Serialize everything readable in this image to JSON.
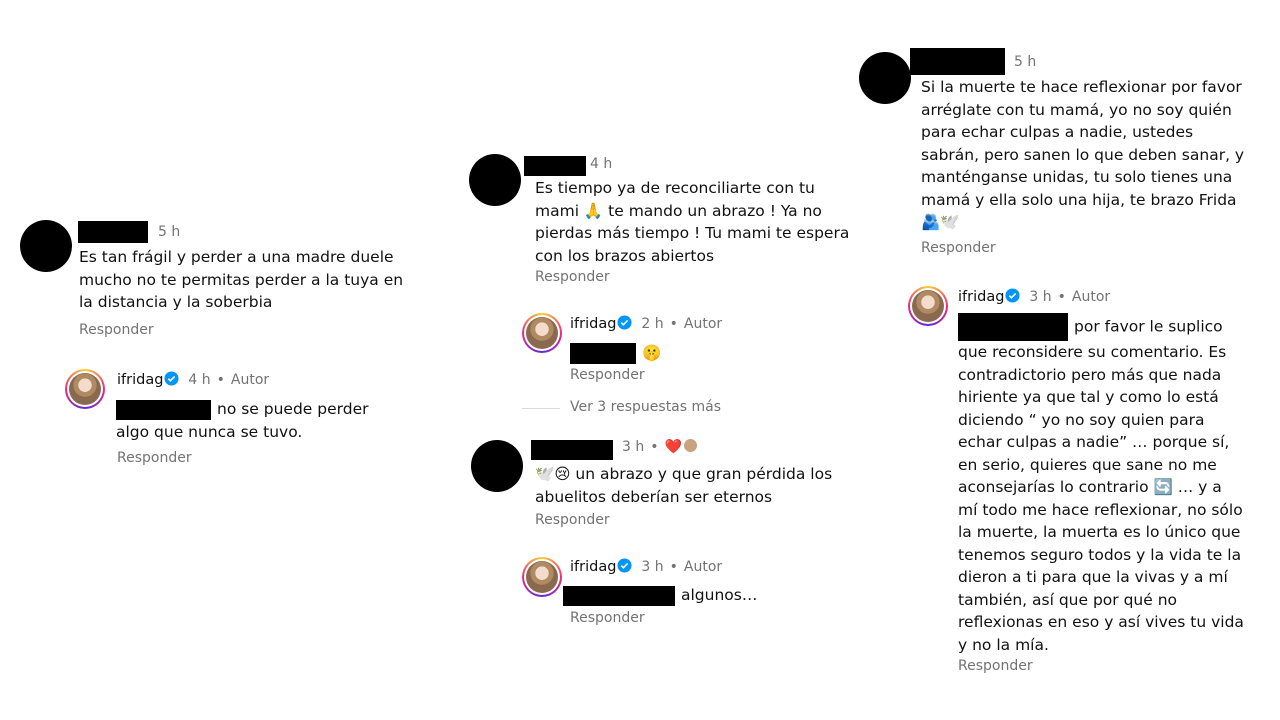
{
  "author": {
    "username": "ifridag",
    "role": "Autor"
  },
  "reply_label": "Responder",
  "col1": {
    "comment": {
      "time": "5 h",
      "lines": [
        "Es tan frágil y perder a una madre duele",
        "mucho no te permitas perder a la tuya en",
        "la distancia y la soberbia"
      ]
    },
    "reply": {
      "time": "4 h",
      "line1": "no se puede perder",
      "line2": "algo que nunca se tuvo."
    }
  },
  "col2": {
    "comment1": {
      "time": "4 h",
      "lines": [
        "Es tiempo ya de reconciliarte con tu",
        "mami 🙏 te mando un abrazo ! Ya no",
        "pierdas más tiempo ! Tu mami te espera",
        "con los brazos abiertos"
      ]
    },
    "reply1": {
      "time": "2 h",
      "text": "🤫"
    },
    "more_replies": "Ver 3 respuestas más",
    "comment2": {
      "time": "3 h",
      "reactions": "❤️",
      "lines": [
        "🕊️😢 un abrazo y que gran pérdida los",
        "abuelitos deberían ser eternos"
      ]
    },
    "reply2": {
      "time": "3 h",
      "text": "algunos…"
    }
  },
  "col3": {
    "comment": {
      "time": "5 h",
      "lines": [
        "Si la muerte te hace reflexionar por favor",
        "arréglate con tu mamá, yo no soy quién",
        "para echar culpas a nadie, ustedes",
        "sabrán, pero sanen lo que deben sanar, y",
        "manténganse unidas, tu solo tienes una",
        "mamá y ella solo una hija, te brazo Frida",
        "🫂🕊️"
      ]
    },
    "reply": {
      "time": "3 h",
      "first_line": "por favor le suplico",
      "lines": [
        "que reconsidere su comentario. Es",
        "contradictorio pero más que nada",
        "hiriente ya que tal y como lo está",
        "diciendo “ yo no soy quien para",
        "echar culpas a nadie” … porque sí,",
        "en serio, quieres que sane no me",
        "aconsejarías lo contrario 🔄 … y a",
        "mí todo me hace reflexionar, no sólo",
        "la muerte, la muerta es lo único que",
        "tenemos seguro todos y la vida te la",
        "dieron a ti para que la vivas y a mí",
        "también, así que por qué no",
        "reflexionas en eso y así vives tu vida",
        "y no la mía."
      ]
    }
  },
  "colors": {
    "verified": "#0095f6",
    "meta": "#737373",
    "text": "#111111"
  },
  "icons": [
    "verified-badge-icon",
    "heart-icon"
  ]
}
